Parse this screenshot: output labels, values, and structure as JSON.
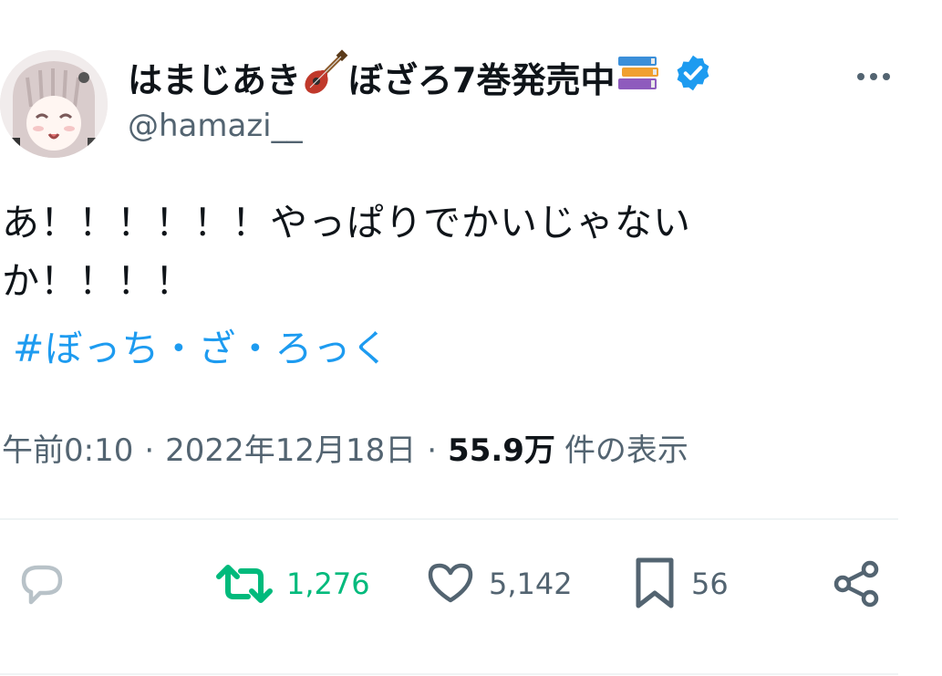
{
  "user": {
    "display_name_part1": "はまじあき",
    "display_name_part2": "ぼざろ7巻発売中",
    "handle": "@hamazi__",
    "name_emojis": [
      "guitar-emoji",
      "books-emoji"
    ],
    "verified": true
  },
  "tweet": {
    "text": "あ！！！！！！やっぱりでかいじゃないか！！！！",
    "hashtag": "#ぼっち・ざ・ろっく"
  },
  "meta": {
    "time": "午前0:10",
    "separator": "·",
    "date": "2022年12月18日",
    "views_count": "55.9万",
    "views_label": "件の表示"
  },
  "actions": {
    "reply_count": "",
    "retweet_count": "1,276",
    "like_count": "5,142",
    "bookmark_count": "56"
  },
  "colors": {
    "accent": "#1d9bf0",
    "retweet_green": "#00ba7c",
    "secondary_text": "#536471",
    "primary_text": "#0f1419"
  }
}
